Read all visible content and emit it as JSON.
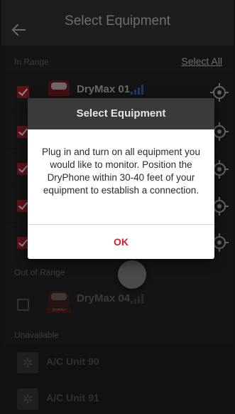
{
  "header": {
    "title": "Select Equipment"
  },
  "sections": {
    "in_range": "In Range",
    "select_all": "Select All",
    "out_of_range": "Out of Range",
    "unavailable": "Unavailable"
  },
  "in_range_items": [
    {
      "name": "DryMax 01",
      "checked": true,
      "signal": "strong"
    },
    {
      "name": "",
      "checked": true
    },
    {
      "name": "",
      "checked": true
    },
    {
      "name": "",
      "checked": true
    },
    {
      "name": "",
      "checked": true
    }
  ],
  "out_of_range_items": [
    {
      "name": "DryMax 04",
      "checked": false,
      "thumb_tag": "DryMAX"
    }
  ],
  "unavailable_items": [
    {
      "name": "A/C Unit 90"
    },
    {
      "name": "A/C Unit 91"
    }
  ],
  "dialog": {
    "title": "Select Equipment",
    "message": "Plug in and turn on all equipment you would like to monitor. Position the DryPhone within 30-40 feet of your equipment to establish a connection.",
    "ok_label": "OK"
  },
  "colors": {
    "accent_red": "#b3202a",
    "ok_red": "#d32030",
    "signal_blue": "#3a6db3",
    "dialog_header": "#3a3a3a"
  }
}
